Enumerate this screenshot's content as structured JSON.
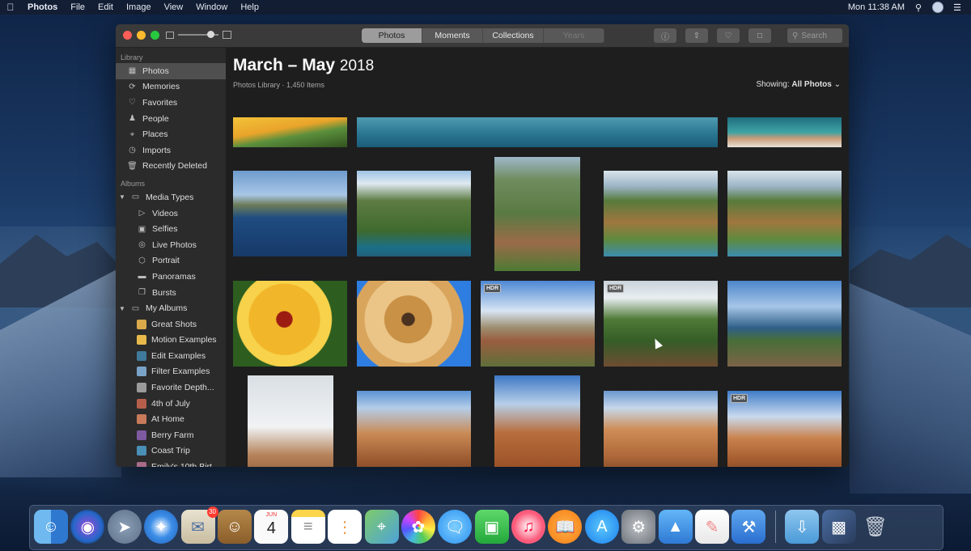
{
  "menubar": {
    "app": "Photos",
    "items": [
      "File",
      "Edit",
      "Image",
      "View",
      "Window",
      "Help"
    ],
    "clock": "Mon 11:38 AM"
  },
  "window": {
    "tabs": [
      "Photos",
      "Moments",
      "Collections",
      "Years"
    ],
    "active_tab": "Photos",
    "search_placeholder": "Search"
  },
  "sidebar": {
    "library_header": "Library",
    "library": [
      {
        "label": "Photos",
        "icon": "photos-grid-icon"
      },
      {
        "label": "Memories",
        "icon": "memories-icon"
      },
      {
        "label": "Favorites",
        "icon": "heart-icon"
      },
      {
        "label": "People",
        "icon": "person-icon"
      },
      {
        "label": "Places",
        "icon": "pin-icon"
      },
      {
        "label": "Imports",
        "icon": "clock-icon"
      },
      {
        "label": "Recently Deleted",
        "icon": "trash-icon"
      }
    ],
    "albums_header": "Albums",
    "media_types_label": "Media Types",
    "media_types": [
      {
        "label": "Videos",
        "icon": "video-icon"
      },
      {
        "label": "Selfies",
        "icon": "selfie-icon"
      },
      {
        "label": "Live Photos",
        "icon": "live-photo-icon"
      },
      {
        "label": "Portrait",
        "icon": "portrait-icon"
      },
      {
        "label": "Panoramas",
        "icon": "panorama-icon"
      },
      {
        "label": "Bursts",
        "icon": "burst-icon"
      }
    ],
    "my_albums_label": "My Albums",
    "my_albums": [
      {
        "label": "Great Shots",
        "color": "#d8a84a"
      },
      {
        "label": "Motion Examples",
        "color": "#e7b94a"
      },
      {
        "label": "Edit Examples",
        "color": "#3f7a9b"
      },
      {
        "label": "Filter Examples",
        "color": "#7aa3c8"
      },
      {
        "label": "Favorite Depth...",
        "color": "#9a9a9a"
      },
      {
        "label": "4th of July",
        "color": "#b55f4a"
      },
      {
        "label": "At Home",
        "color": "#c87a5a"
      },
      {
        "label": "Berry Farm",
        "color": "#7e5aa0"
      },
      {
        "label": "Coast Trip",
        "color": "#4a8fb5"
      },
      {
        "label": "Emily's 10th Birt...",
        "color": "#aa6b8a"
      }
    ]
  },
  "main": {
    "title_bold": "March – May",
    "title_year": "2018",
    "subtitle": "Photos Library · 1,450 Items",
    "showing_label": "Showing:",
    "showing_value": "All Photos",
    "hdr_label": "HDR"
  },
  "dock": {
    "mail_badge": "30",
    "calendar_month": "JUN",
    "calendar_day": "4"
  }
}
